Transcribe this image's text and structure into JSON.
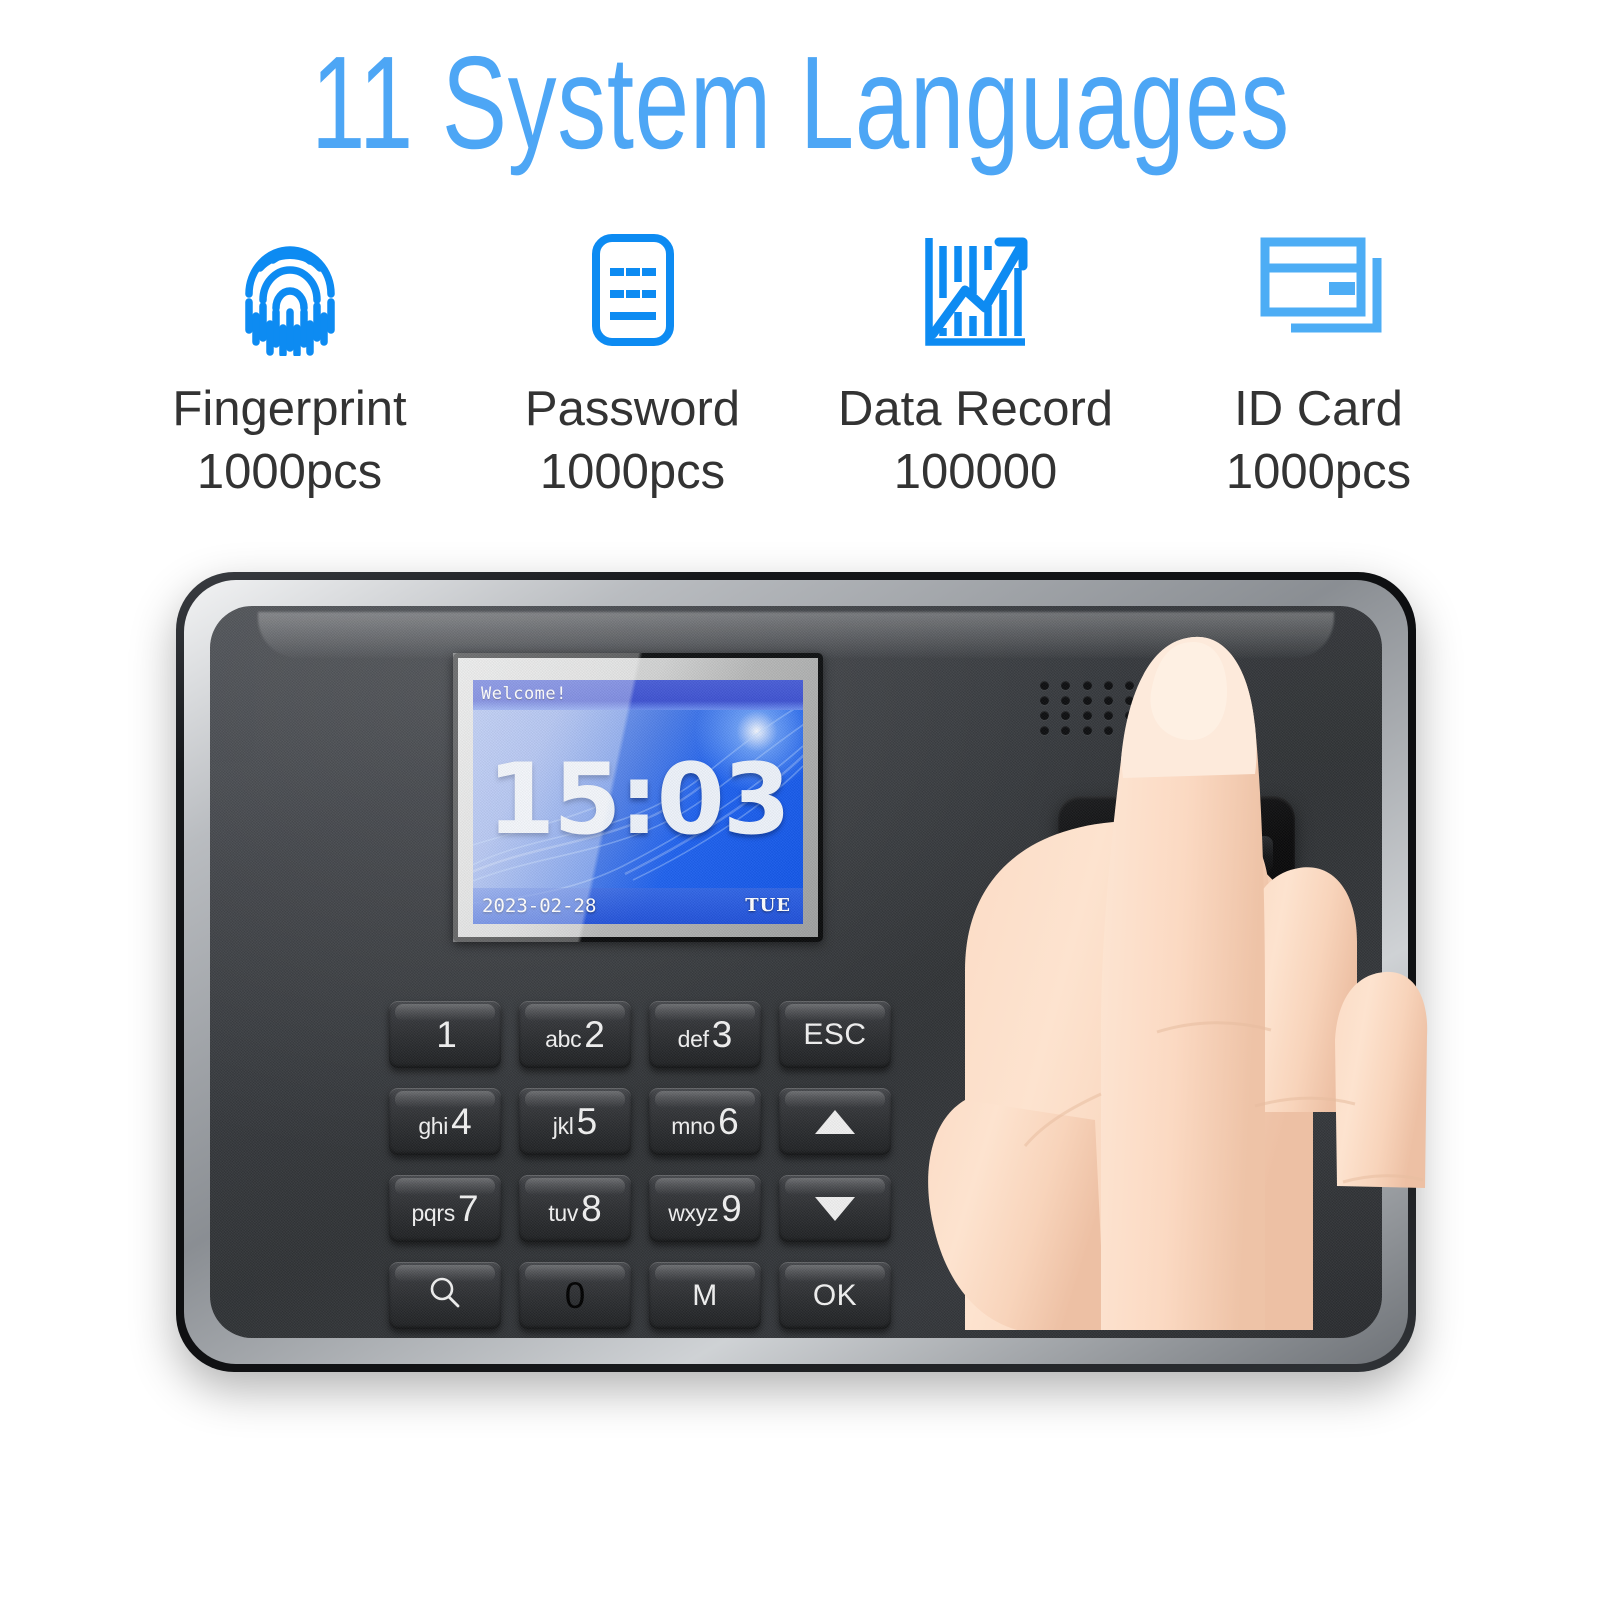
{
  "header": {
    "title": "11 System Languages",
    "title_color": "#4da6f5"
  },
  "features": {
    "icon_color": "#0d8bf2",
    "items": [
      {
        "icon": "fingerprint-icon",
        "label": "Fingerprint",
        "count": "1000pcs"
      },
      {
        "icon": "password-icon",
        "label": "Password",
        "count": "1000pcs"
      },
      {
        "icon": "data-record-icon",
        "label": "Data Record",
        "count": "100000"
      },
      {
        "icon": "id-card-icon",
        "label": "ID Card",
        "count": "1000pcs"
      }
    ]
  },
  "device": {
    "screen": {
      "welcome": "Welcome!",
      "time": "15:03",
      "date": "2023-02-28",
      "weekday": "TUE"
    },
    "sensor": {
      "name": "fingerprint-sensor"
    },
    "speaker": {
      "name": "speaker-grille"
    },
    "keypad": {
      "keys": [
        {
          "name": "key-1",
          "alpha": "",
          "digit": "1",
          "word": "",
          "icon": ""
        },
        {
          "name": "key-2",
          "alpha": "abc",
          "digit": "2",
          "word": "",
          "icon": ""
        },
        {
          "name": "key-3",
          "alpha": "def",
          "digit": "3",
          "word": "",
          "icon": ""
        },
        {
          "name": "key-esc",
          "alpha": "",
          "digit": "",
          "word": "ESC",
          "icon": ""
        },
        {
          "name": "key-4",
          "alpha": "ghi",
          "digit": "4",
          "word": "",
          "icon": ""
        },
        {
          "name": "key-5",
          "alpha": "jkl",
          "digit": "5",
          "word": "",
          "icon": ""
        },
        {
          "name": "key-6",
          "alpha": "mno",
          "digit": "6",
          "word": "",
          "icon": ""
        },
        {
          "name": "key-up",
          "alpha": "",
          "digit": "",
          "word": "",
          "icon": "arrow-up-icon"
        },
        {
          "name": "key-7",
          "alpha": "pqrs",
          "digit": "7",
          "word": "",
          "icon": ""
        },
        {
          "name": "key-8",
          "alpha": "tuv",
          "digit": "8",
          "word": "",
          "icon": ""
        },
        {
          "name": "key-9",
          "alpha": "wxyz",
          "digit": "9",
          "word": "",
          "icon": ""
        },
        {
          "name": "key-down",
          "alpha": "",
          "digit": "",
          "word": "",
          "icon": "arrow-down-icon"
        },
        {
          "name": "key-search",
          "alpha": "",
          "digit": "",
          "word": "",
          "icon": "search-icon"
        },
        {
          "name": "key-0",
          "alpha": "",
          "digit": "0",
          "word": "",
          "icon": ""
        },
        {
          "name": "key-menu",
          "alpha": "",
          "digit": "",
          "word": "M",
          "icon": ""
        },
        {
          "name": "key-ok",
          "alpha": "",
          "digit": "",
          "word": "OK",
          "icon": ""
        }
      ]
    }
  }
}
